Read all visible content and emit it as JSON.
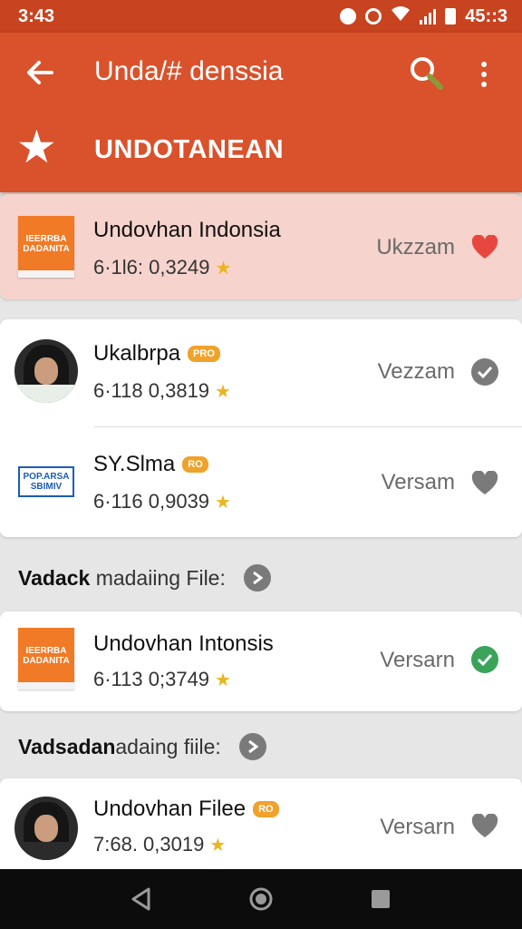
{
  "status_bar": {
    "time": "3:43",
    "clock_right": "45::3",
    "icons": [
      "alert-icon",
      "alarm-icon",
      "wifi-icon",
      "signal-icon",
      "battery-icon"
    ]
  },
  "app_bar": {
    "title": "Unda/# denssia",
    "section_title": "UNDOTANEAN",
    "icons": [
      "back-arrow-icon",
      "search-icon",
      "more-vert-icon",
      "star-icon"
    ]
  },
  "colors": {
    "app_bar": "#d9522c",
    "status_bar": "#c8431f",
    "highlight": "#f6d3cc",
    "heart_red": "#e8473f",
    "check_green": "#3aa35a",
    "check_gray": "#7a7a7a",
    "star_gold": "#e9b520",
    "pro_badge": "#f0a22a"
  },
  "featured": {
    "title": "Undovhan Indonsia",
    "meta": "6·1l6: 0,3249",
    "action_label": "Ukzzam",
    "action_icon": "heart-icon",
    "thumb_text": "IEERRBA DADANITA"
  },
  "group1": [
    {
      "title": "Ukalbrpa",
      "badge": "PRO",
      "meta": "6·118 0,3819",
      "action_label": "Vezzam",
      "action_icon": "check-circle-icon",
      "thumb": "avatar"
    },
    {
      "title": "SY.Slma",
      "badge": "RO",
      "meta": "6·116 0,9039",
      "action_label": "Versam",
      "action_icon": "heart-icon",
      "thumb": "logo",
      "thumb_text": "POP.ARSA SBIMIV"
    }
  ],
  "subheader1": {
    "bold": "Vadack",
    "light": "madaiing File:"
  },
  "group2": [
    {
      "title": "Undovhan Intonsis",
      "meta": "6·113 0;3749",
      "action_label": "Versarn",
      "action_icon": "check-circle-icon",
      "thumb_text": "IEERRBA DADANITA"
    }
  ],
  "subheader2": {
    "bold": "Vadsadan",
    "light": "adaing fiile:"
  },
  "group3": [
    {
      "title": "Undovhan Filee",
      "badge": "RO",
      "meta": "7:68. 0,3019",
      "action_label": "Versarn",
      "action_icon": "heart-icon",
      "thumb": "avatar"
    }
  ],
  "nav_bar": {
    "icons": [
      "back-triangle-icon",
      "home-circle-icon",
      "recents-square-icon"
    ]
  }
}
